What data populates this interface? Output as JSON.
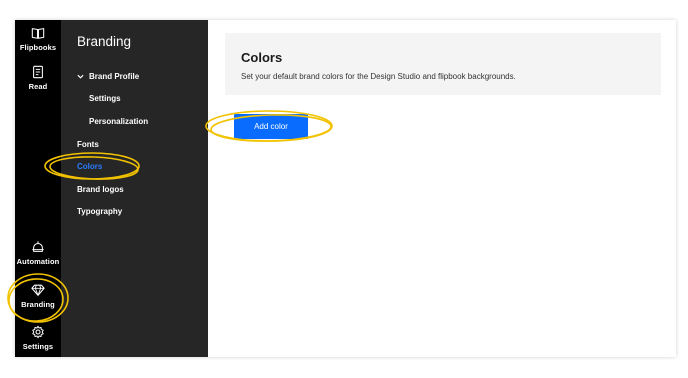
{
  "rail": {
    "items": [
      {
        "label": "Flipbooks",
        "icon": "book-open-icon"
      },
      {
        "label": "Read",
        "icon": "read-document-icon"
      },
      {
        "label": "Automation",
        "icon": "robot-icon"
      },
      {
        "label": "Branding",
        "icon": "diamond-icon"
      },
      {
        "label": "Settings",
        "icon": "gear-icon"
      }
    ]
  },
  "subnav": {
    "title": "Branding",
    "brand_profile": "Brand Profile",
    "settings": "Settings",
    "personalization": "Personalization",
    "fonts": "Fonts",
    "colors": "Colors",
    "brand_logos": "Brand logos",
    "typography": "Typography"
  },
  "main": {
    "title": "Colors",
    "description": "Set your default brand colors for the Design Studio and flipbook backgrounds.",
    "add_button": "Add color"
  },
  "colors": {
    "rail_bg": "#000000",
    "subnav_bg": "#262626",
    "active_link": "#2b7bff",
    "button_bg": "#0a6cff",
    "card_bg": "#f4f4f4",
    "highlight": "#f2c200"
  }
}
